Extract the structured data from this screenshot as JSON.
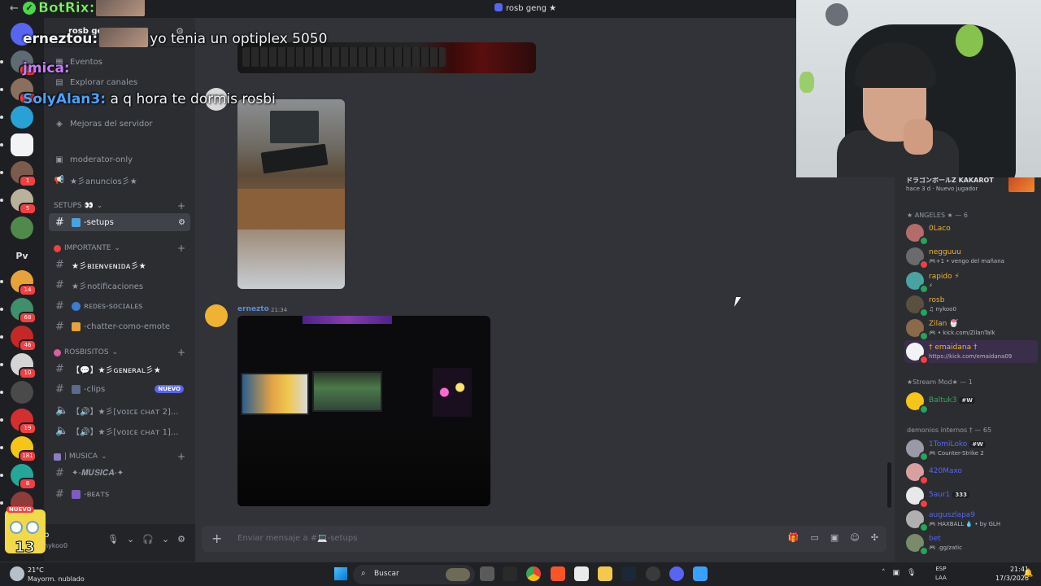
{
  "window": {
    "title": "rosb geng ★"
  },
  "server": {
    "name": "rosb geng",
    "nav": [
      {
        "label": "Eventos",
        "icon": "calendar-icon"
      },
      {
        "label": "Explorar canales",
        "icon": "browse-icon"
      },
      {
        "label": "Mejoras del servidor",
        "icon": "boost-icon"
      }
    ],
    "top_channels": [
      {
        "label": "moderator-only",
        "icon": "rules-icon"
      },
      {
        "label": "★彡anuncios彡★",
        "icon": "announce-icon"
      }
    ],
    "categories": [
      {
        "label": "SETUPS 👀",
        "channels": [
          {
            "label": "-setups",
            "active": true
          }
        ]
      },
      {
        "label": "IMPORTANTE",
        "channels": [
          {
            "label": "★彡ʙɪᴇɴᴠᴇɴɪᴅᴀ彡★"
          },
          {
            "label": "★彡notificaciones"
          },
          {
            "label": "ʀᴇᴅᴇs-sᴏᴄɪᴀʟᴇs"
          },
          {
            "label": "-chatter-como-emote"
          }
        ]
      },
      {
        "label": "ROSBISITOS",
        "channels": [
          {
            "label": "【💬】★彡ɢᴇɴᴇʀᴀʟ彡★"
          },
          {
            "label": "-clips",
            "badge": "NUEVO"
          },
          {
            "label": "【🔊】★彡[ᴠᴏɪᴄᴇ ᴄʜᴀᴛ 2]..."
          },
          {
            "label": "【🔊】★彡[ᴠᴏɪᴄᴇ ᴄʜᴀᴛ 1]..."
          }
        ]
      },
      {
        "label": "| MUSICA",
        "channels": [
          {
            "label": "✦-𝑴𝑼𝑺𝑰𝑪𝑨-✦"
          },
          {
            "label": "-ʙᴇᴀᴛs"
          }
        ]
      }
    ],
    "guild_badges": [
      "1",
      "1",
      "",
      "1",
      "1",
      "5",
      "",
      "",
      "14",
      "68",
      "46",
      "10",
      "",
      "19",
      "181",
      "8"
    ],
    "guild_pv": "Pv"
  },
  "user": {
    "name": "b",
    "status": "nykoo0"
  },
  "chat": {
    "messages": [
      {
        "author": "ernezto",
        "time": "21:34"
      }
    ],
    "composer_placeholder": "Enviar mensaje a #💻-setups"
  },
  "members": {
    "top_entry": {
      "name": "ドラゴンボールZ KAKAROT",
      "sub": "hace 3 d · Nuevo jugador"
    },
    "groups": [
      {
        "label": "★ ANGELES ★ — 6",
        "members": [
          {
            "name": "0Laco",
            "sub": "",
            "color": "#f0b232"
          },
          {
            "name": "negguuu",
            "sub": "🎮+1 • vengo del mañana",
            "color": "#f0b232"
          },
          {
            "name": "rapido ⚡",
            "sub": "⚡",
            "color": "#f0b232"
          },
          {
            "name": "rosb",
            "sub": "♫ nykoo0",
            "color": "#f0b232"
          },
          {
            "name": "Zilan 🍧",
            "sub": "🎮 • kick.com/ZilanTalk",
            "color": "#f0b232"
          },
          {
            "name": "† emaidana †",
            "sub": "https://kick.com/emaidana09",
            "color": "#f0b232"
          }
        ]
      },
      {
        "label": "★Stream Mod★ — 1",
        "members": [
          {
            "name": "Baltuk3",
            "sub": "",
            "color": "#3ba55c",
            "tag": "#W"
          }
        ]
      },
      {
        "label": "demonios internos † — 65",
        "members": [
          {
            "name": "1TomiLoko",
            "sub": "🎮 Counter-Strike 2",
            "color": "#5865f2",
            "tag": "#W"
          },
          {
            "name": "420Maxo",
            "sub": "",
            "color": "#5865f2"
          },
          {
            "name": "5aur1",
            "sub": "",
            "color": "#5865f2",
            "tag": "333"
          },
          {
            "name": "auguszlapa9",
            "sub": "🎮 HAXBALL 💧 • by GLH",
            "color": "#5865f2"
          },
          {
            "name": "bet",
            "sub": "🎮 .gg/zatic",
            "color": "#5865f2"
          }
        ]
      }
    ]
  },
  "overlay": {
    "brand": "BotRix:",
    "lines": [
      {
        "name": "erneztou:",
        "text": "yo tenia un optiplex 5050"
      },
      {
        "name": "jmica:",
        "text": ""
      },
      {
        "name": "SolyAlan3:",
        "text": "a q hora te dormis rosbi"
      }
    ]
  },
  "taskbar": {
    "weather_temp": "21°C",
    "weather_desc": "Mayorm. nublado",
    "search_label": "Buscar",
    "lang_1": "ESP",
    "lang_2": "LAA",
    "time": "21:41",
    "date": "17/3/2026"
  },
  "corner_badge": {
    "new": "NUEVO",
    "number": "13"
  },
  "colors": {
    "accent": "#5865f2",
    "online": "#23a55a",
    "dnd": "#f23f43",
    "botrix": "#7ff06d"
  }
}
